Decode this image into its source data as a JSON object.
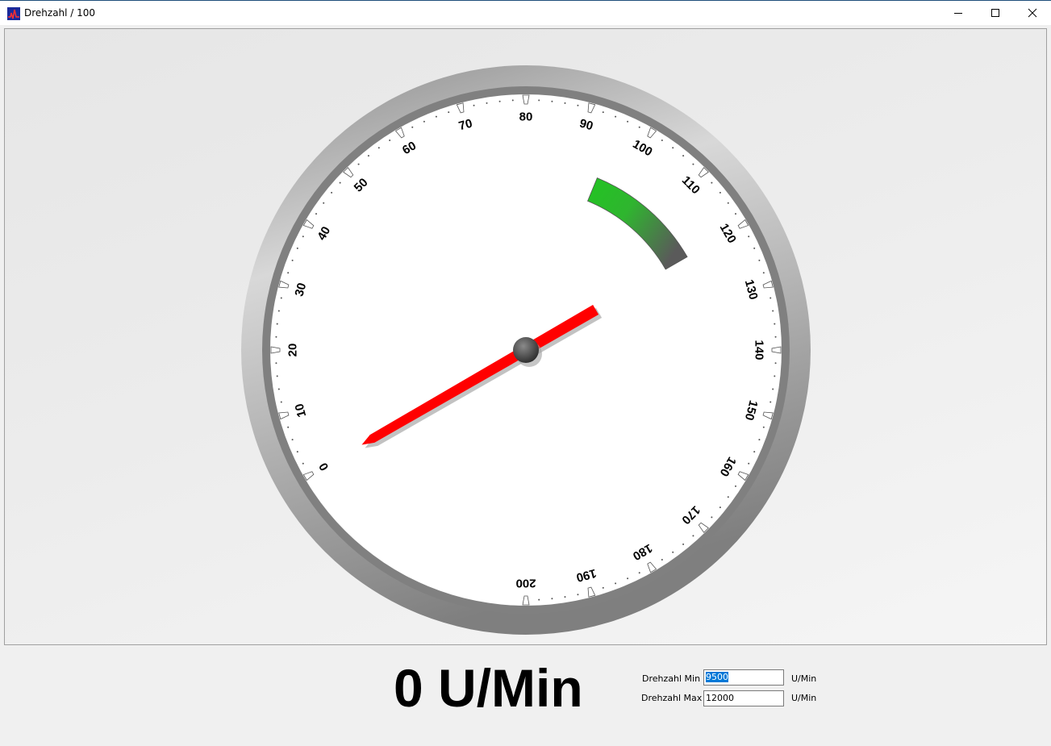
{
  "window": {
    "title": "Drehzahl / 100",
    "icon": "chart-app-icon",
    "controls": [
      "minimize-icon",
      "maximize-icon",
      "close-icon"
    ]
  },
  "gauge": {
    "scale_min": 0,
    "scale_max": 200,
    "major_step": 10,
    "labels": [
      "0",
      "10",
      "20",
      "30",
      "40",
      "50",
      "60",
      "70",
      "80",
      "90",
      "100",
      "110",
      "120",
      "130",
      "140",
      "150",
      "160",
      "170",
      "180",
      "190",
      "200"
    ],
    "needle_value": 0,
    "range_band": {
      "from": 95,
      "to": 120,
      "color_start": "#22c422",
      "color_end": "#5a5a5a"
    },
    "needle_color": "#ff0000",
    "bezel_color": "#7f7f7f"
  },
  "readout": {
    "value": "0 U/Min"
  },
  "settings": {
    "min_label": "Drehzahl Min",
    "min_value": "9500",
    "min_unit": "U/Min",
    "max_label": "Drehzahl Max",
    "max_value": "12000",
    "max_unit": "U/Min"
  }
}
